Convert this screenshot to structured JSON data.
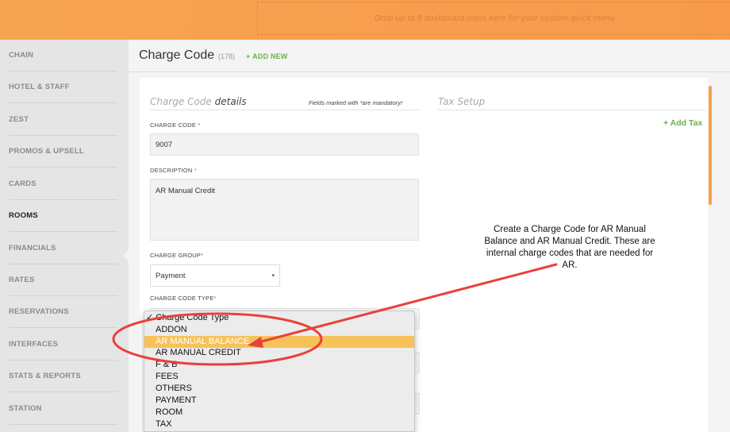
{
  "quick_menu": {
    "placeholder": "Drop up to 8 dashboard icons here for your custom quick menu"
  },
  "sidebar": {
    "items": [
      {
        "label": "CHAIN"
      },
      {
        "label": "HOTEL & STAFF"
      },
      {
        "label": "ZEST"
      },
      {
        "label": "PROMOS & UPSELL"
      },
      {
        "label": "CARDS"
      },
      {
        "label": "ROOMS",
        "active": true
      },
      {
        "label": "FINANCIALS"
      },
      {
        "label": "RATES"
      },
      {
        "label": "RESERVATIONS"
      },
      {
        "label": "INTERFACES"
      },
      {
        "label": "STATS & REPORTS"
      },
      {
        "label": "STATION"
      }
    ]
  },
  "page": {
    "title": "Charge Code",
    "count": "(178)",
    "add_new": "ADD NEW"
  },
  "details": {
    "title_prefix": "Charge Code",
    "title_suffix": "details",
    "mandatory_note": "Fields marked with *are mandatory!",
    "charge_code": {
      "label": "CHARGE CODE",
      "required": "*",
      "value": "9007"
    },
    "description": {
      "label": "DESCRIPTION",
      "required": "*",
      "value": "AR Manual Credit"
    },
    "charge_group": {
      "label": "CHARGE GROUP",
      "required": "*",
      "value": "Payment"
    },
    "charge_code_type": {
      "label": "CHARGE CODE TYPE",
      "required": "*"
    }
  },
  "tax": {
    "title": "Tax Setup",
    "add_tax": "Add Tax"
  },
  "dropdown": {
    "options": [
      {
        "label": "Charge Code Type",
        "checked": true
      },
      {
        "label": "ADDON"
      },
      {
        "label": "AR MANUAL BALANCE",
        "highlighted": true
      },
      {
        "label": "AR MANUAL CREDIT"
      },
      {
        "label": "F & B"
      },
      {
        "label": "FEES"
      },
      {
        "label": "OTHERS"
      },
      {
        "label": "PAYMENT"
      },
      {
        "label": "ROOM"
      },
      {
        "label": "TAX"
      }
    ]
  },
  "annotation": {
    "lines": [
      "Create a Charge Code for AR Manual",
      "Balance and AR Manual Credit.  These are",
      "internal charge codes that are needed for",
      "AR."
    ],
    "color": "#e8413a"
  },
  "colors": {
    "accent": "#f79a4b",
    "green": "#6ab04c",
    "highlight": "#f7c259",
    "required": "#e5533d"
  }
}
